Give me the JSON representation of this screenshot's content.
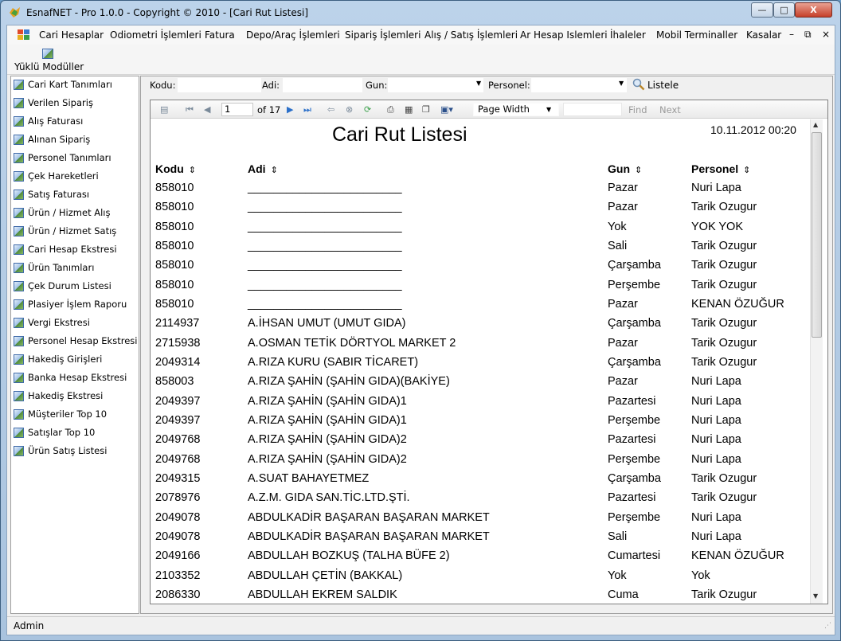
{
  "window": {
    "title": "EsnafNET - Pro 1.0.0 - Copyright ©  2010 - [Cari Rut Listesi]",
    "minimize": "—",
    "maximize": "□",
    "close": "X"
  },
  "menu": {
    "items": [
      "Cari Hesaplar",
      "Odiometri İşlemleri",
      "Fatura",
      "Depo/Araç İşlemleri",
      "Sipariş İşlemleri",
      "Alış / Satış İşlemleri",
      "Ar Hesap Islemleri",
      "İhaleler",
      "Mobil Terminaller",
      "Kasalar"
    ],
    "mdi_controls": [
      "–",
      "⧉",
      "×"
    ]
  },
  "loaded_modules_label": "Yüklü Modüller",
  "sidebar": {
    "items": [
      "Cari Kart Tanımları",
      "Verilen Sipariş",
      "Alış Faturası",
      "Alınan Sipariş",
      "Personel Tanımları",
      "Çek Hareketleri",
      "Satış Faturası",
      "Ürün / Hizmet Alış",
      "Ürün / Hizmet Satış",
      "Cari Hesap Ekstresi",
      "Ürün Tanımları",
      "Çek Durum Listesi",
      "Plasiyer İşlem Raporu",
      "Vergi Ekstresi",
      "Personel Hesap Ekstresi",
      "Hakediş Girişleri",
      "Banka Hesap Ekstresi",
      "Hakediş Ekstresi",
      "Müşteriler Top 10",
      "Satışlar Top 10",
      "Ürün Satış Listesi"
    ]
  },
  "filters": {
    "kodu_label": "Kodu:",
    "adi_label": "Adi:",
    "gun_label": "Gun:",
    "personel_label": "Personel:",
    "list_button": "Listele"
  },
  "viewer": {
    "current_page": "1",
    "of_label": "of 17",
    "zoom": "Page Width",
    "find": "Find",
    "next": "Next"
  },
  "report": {
    "title": "Cari Rut Listesi",
    "date": "10.11.2012 00:20",
    "columns": [
      "Kodu",
      "Adi",
      "Gun",
      "Personel"
    ],
    "rows": [
      [
        "858010",
        "________________________",
        "Pazar",
        "Nuri Lapa"
      ],
      [
        "858010",
        "________________________",
        "Pazar",
        "Tarik Ozugur"
      ],
      [
        "858010",
        "________________________",
        "Yok",
        "YOK YOK"
      ],
      [
        "858010",
        "________________________",
        "Sali",
        "Tarik Ozugur"
      ],
      [
        "858010",
        "________________________",
        "Çarşamba",
        "Tarik Ozugur"
      ],
      [
        "858010",
        "________________________",
        "Perşembe",
        "Tarik Ozugur"
      ],
      [
        "858010",
        "________________________",
        "Pazar",
        "KENAN ÖZUĞUR"
      ],
      [
        "2114937",
        "A.İHSAN UMUT (UMUT GIDA)",
        "Çarşamba",
        "Tarik Ozugur"
      ],
      [
        "2715938",
        "A.OSMAN TETİK  DÖRTYOL MARKET 2",
        "Pazar",
        "Tarik Ozugur"
      ],
      [
        "2049314",
        "A.RIZA KURU (SABIR TİCARET)",
        "Çarşamba",
        "Tarik Ozugur"
      ],
      [
        "858003",
        "A.RIZA ŞAHİN (ŞAHİN GIDA)(BAKİYE)",
        "Pazar",
        "Nuri Lapa"
      ],
      [
        "2049397",
        "A.RIZA ŞAHİN (ŞAHİN GIDA)1",
        "Pazartesi",
        "Nuri Lapa"
      ],
      [
        "2049397",
        "A.RIZA ŞAHİN (ŞAHİN GIDA)1",
        "Perşembe",
        "Nuri Lapa"
      ],
      [
        "2049768",
        "A.RIZA ŞAHİN (ŞAHİN GIDA)2",
        "Pazartesi",
        "Nuri Lapa"
      ],
      [
        "2049768",
        "A.RIZA ŞAHİN (ŞAHİN GIDA)2",
        "Perşembe",
        "Nuri Lapa"
      ],
      [
        "2049315",
        "A.SUAT BAHAYETMEZ",
        "Çarşamba",
        "Tarik Ozugur"
      ],
      [
        "2078976",
        "A.Z.M. GIDA SAN.TİC.LTD.ŞTİ.",
        "Pazartesi",
        "Tarik Ozugur"
      ],
      [
        "2049078",
        "ABDULKADİR BAŞARAN BAŞARAN MARKET",
        "Perşembe",
        "Nuri Lapa"
      ],
      [
        "2049078",
        "ABDULKADİR BAŞARAN BAŞARAN MARKET",
        "Sali",
        "Nuri Lapa"
      ],
      [
        "2049166",
        "ABDULLAH BOZKUŞ (TALHA BÜFE 2)",
        "Cumartesi",
        "KENAN ÖZUĞUR"
      ],
      [
        "2103352",
        "ABDULLAH ÇETİN (BAKKAL)",
        "Yok",
        "Yok"
      ],
      [
        "2086330",
        "ABDULLAH EKREM SALDIK",
        "Cuma",
        "Tarik Ozugur"
      ]
    ]
  },
  "status": {
    "user": "Admin"
  }
}
